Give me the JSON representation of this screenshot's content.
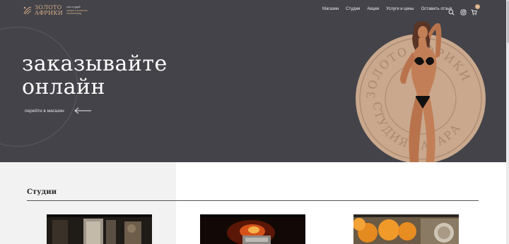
{
  "header": {
    "logo_line1": "ЗОЛОТО",
    "logo_line2": "АФРИКИ",
    "tagline_line1": "сеть студий",
    "tagline_line2": "загара в регионах",
    "tagline_line3": "калининград",
    "nav": [
      "Магазин",
      "Студии",
      "Акции",
      "Услуги и цены",
      "Оставить отзыв"
    ],
    "cart_count": "0"
  },
  "hero": {
    "title_line1": "заказывайте",
    "title_line2": "онлайн",
    "link_label": "перейти в магазин",
    "stamp_text_top": "ЗОЛОТО АФРИКИ",
    "stamp_text_bottom": "СТУДИЯ ЗАГАРА"
  },
  "studios": {
    "title": "Студии"
  },
  "colors": {
    "hero_bg": "#434349",
    "accent": "#d7ad85",
    "stamp": "#c9a88d"
  },
  "icons": [
    "logo-icon",
    "search-icon",
    "instagram-icon",
    "cart-icon",
    "arrow-left-icon"
  ]
}
